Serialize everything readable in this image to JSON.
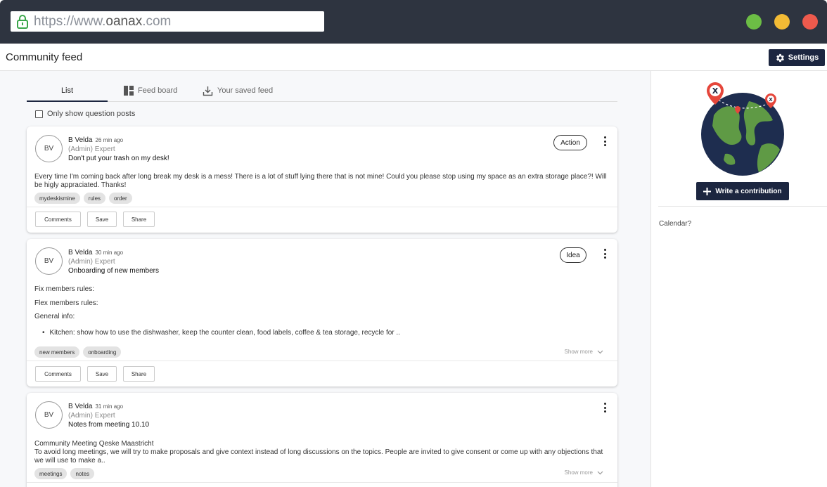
{
  "browser": {
    "url_prefix": "https://www.",
    "url_domain": "oanax",
    "url_suffix": ".com",
    "dots": [
      "#6cbd45",
      "#f3bb35",
      "#ee5a4d"
    ]
  },
  "header": {
    "title": "Community feed",
    "settings_label": "Settings"
  },
  "tabs": [
    {
      "label": "List",
      "icon": "list"
    },
    {
      "label": "Feed board",
      "icon": "grid-icon"
    },
    {
      "label": "Your saved feed",
      "icon": "download-icon"
    }
  ],
  "filter": {
    "label": "Only show question posts",
    "checked": false
  },
  "posts": [
    {
      "initials": "BV",
      "author": "B Velda",
      "time": "26 min ago",
      "role": "(Admin) Expert",
      "title": "Don't put your trash on my desk!",
      "badge": "Action",
      "body": "Every time I'm coming back after long break my desk is a mess! There is a lot of stuff lying there that is not mine! Could you please stop using my space as an extra storage place?! Will be higly appraciated. Thanks!",
      "tags": [
        "mydeskismine",
        "rules",
        "order"
      ],
      "actions": [
        "Comments",
        "Save",
        "Share"
      ]
    },
    {
      "initials": "BV",
      "author": "B Velda",
      "time": "30 min ago",
      "role": "(Admin) Expert",
      "title": "Onboarding of new members",
      "badge": "Idea",
      "lines": [
        "Fix members rules:",
        "Flex members rules:",
        "General info:"
      ],
      "bullet": "Kitchen: show how to use the dishwasher, keep the counter clean, food labels, coffee & tea storage, recycle for ..",
      "tags": [
        "new members",
        "onboarding"
      ],
      "show_more": "Show more",
      "actions": [
        "Comments",
        "Save",
        "Share"
      ]
    },
    {
      "initials": "BV",
      "author": "B Velda",
      "time": "31 min ago",
      "role": "(Admin) Expert",
      "title": "Notes from meeting 10.10",
      "body_line1": "Community Meeting Qeske Maastricht",
      "body_line2": "To avoid long meetings, we will try to make proposals and give context instead of long discussions on the topics. People are invited to give consent or come up with any objections that we will use to make a..",
      "tags": [
        "meetings",
        "notes"
      ],
      "show_more": "Show more"
    }
  ],
  "sidebar": {
    "write_label": "Write a contribution",
    "calendar_label": "Calendar?"
  },
  "colors": {
    "navy": "#1c2640",
    "chrome": "#2e3440",
    "globe_ocean": "#1e2d4f",
    "globe_land": "#5f9a45",
    "pin_red": "#e5463b"
  }
}
